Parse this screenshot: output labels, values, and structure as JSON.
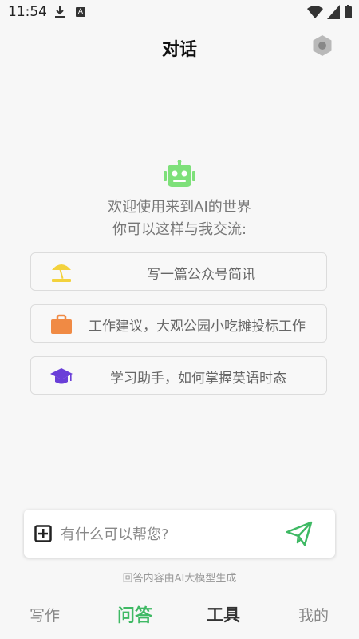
{
  "status": {
    "time": "11:54",
    "a_badge": "A"
  },
  "header": {
    "title": "对话"
  },
  "welcome": {
    "line1": "欢迎使用来到AI的世界",
    "line2": "你可以这样与我交流:"
  },
  "prompts": [
    {
      "text": "写一篇公众号简讯",
      "icon": "beach-umbrella-icon"
    },
    {
      "text": "工作建议，大观公园小吃摊投标工作",
      "icon": "briefcase-icon"
    },
    {
      "text": "学习助手，如何掌握英语时态",
      "icon": "graduation-cap-icon"
    }
  ],
  "chat": {
    "placeholder": "有什么可以帮您?"
  },
  "disclaimer": "回答内容由AI大模型生成",
  "tabs": [
    {
      "label": "写作"
    },
    {
      "label": "问答"
    },
    {
      "label": "工具"
    },
    {
      "label": "我的"
    }
  ],
  "colors": {
    "accent": "#3fb964",
    "robot": "#7ee07a",
    "umbrella": "#f3d23d",
    "briefcase": "#f08a44",
    "cap": "#6a3fd8"
  }
}
